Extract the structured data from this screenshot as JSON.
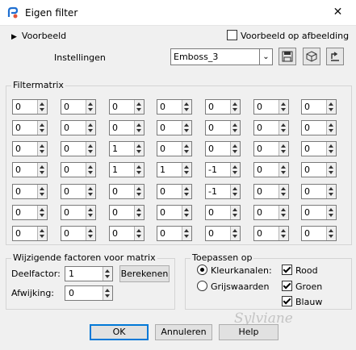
{
  "window": {
    "title": "Eigen filter",
    "close_glyph": "✕"
  },
  "preview": {
    "label": "Voorbeeld",
    "on_image_label": "Voorbeeld op afbeelding",
    "on_image_checked": false
  },
  "settings": {
    "label": "Instellingen",
    "preset_value": "Emboss_3",
    "toolbar_icons": [
      "save-icon",
      "cube-icon",
      "reset-icon"
    ]
  },
  "filtermatrix": {
    "title": "Filtermatrix",
    "rows": [
      [
        "0",
        "0",
        "0",
        "0",
        "0",
        "0",
        "0"
      ],
      [
        "0",
        "0",
        "0",
        "0",
        "0",
        "0",
        "0"
      ],
      [
        "0",
        "0",
        "1",
        "0",
        "0",
        "0",
        "0"
      ],
      [
        "0",
        "0",
        "1",
        "1",
        "-1",
        "0",
        "0"
      ],
      [
        "0",
        "0",
        "0",
        "0",
        "-1",
        "0",
        "0"
      ],
      [
        "0",
        "0",
        "0",
        "0",
        "0",
        "0",
        "0"
      ],
      [
        "0",
        "0",
        "0",
        "0",
        "0",
        "0",
        "0"
      ]
    ]
  },
  "factors": {
    "title": "Wijzigende factoren voor matrix",
    "divisor_label": "Deelfactor:",
    "divisor_value": "1",
    "bias_label": "Afwijking:",
    "bias_value": "0",
    "compute_label": "Berekenen"
  },
  "apply_to": {
    "title": "Toepassen op",
    "color_channels_label": "Kleurkanalen:",
    "color_channels_selected": true,
    "grayscale_label": "Grijswaarden",
    "grayscale_selected": false,
    "red_label": "Rood",
    "green_label": "Groen",
    "blue_label": "Blauw",
    "red_checked": true,
    "green_checked": true,
    "blue_checked": true
  },
  "buttons": {
    "ok": "OK",
    "cancel": "Annuleren",
    "help": "Help"
  },
  "watermark": "Sylviane"
}
